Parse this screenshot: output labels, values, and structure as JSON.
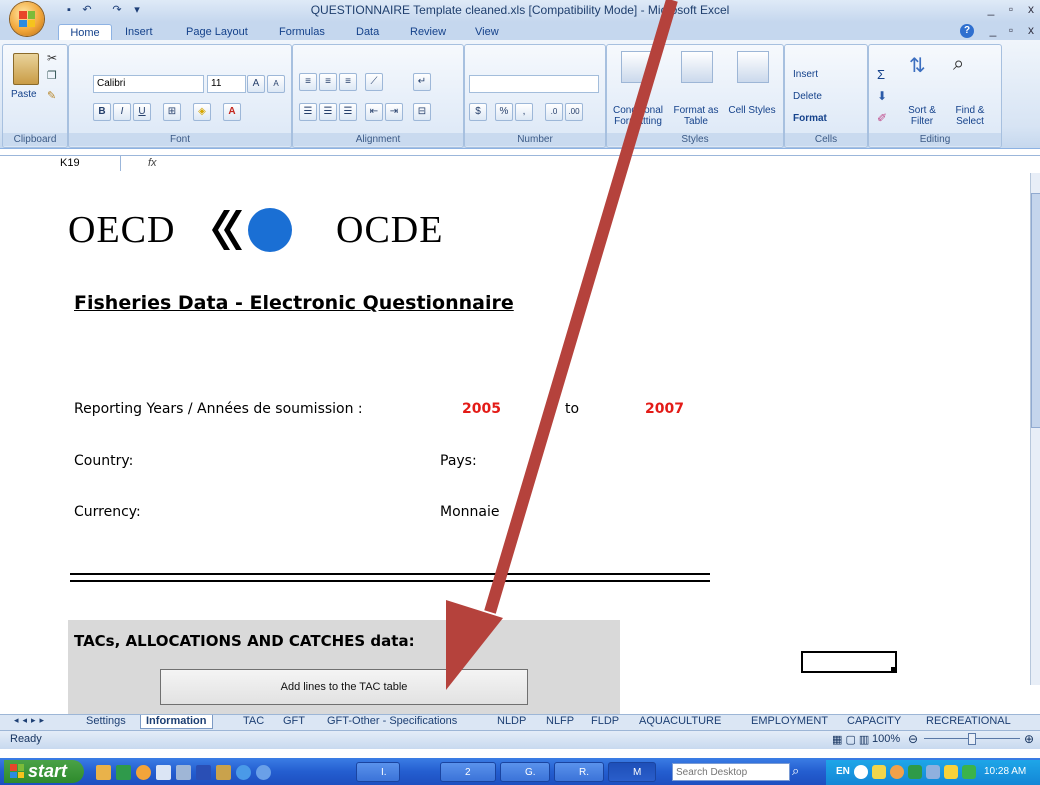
{
  "window": {
    "title": "QUESTIONNAIRE Template cleaned.xls  [Compatibility Mode]  - Microsoft Excel",
    "minimize": "_",
    "restore": "▫",
    "close": "x",
    "help": "?"
  },
  "ribbon_tabs": [
    "Home",
    "Insert",
    "Page Layout",
    "Formulas",
    "Data",
    "Review",
    "View"
  ],
  "ribbon": {
    "clipboard": {
      "label": "Clipboard",
      "paste": "Paste"
    },
    "font": {
      "label": "Font",
      "font_name": "Calibri",
      "font_size": "11",
      "bold": "B",
      "italic": "I",
      "underline": "U"
    },
    "alignment": {
      "label": "Alignment"
    },
    "number": {
      "label": "Number",
      "percent": "%",
      "comma": ","
    },
    "styles": {
      "label": "Styles",
      "conditional": "Conditional Formatting",
      "format_table": "Format as Table",
      "cell_styles": "Cell Styles"
    },
    "cells": {
      "label": "Cells",
      "insert": "Insert",
      "delete": "Delete",
      "format": "Format"
    },
    "editing": {
      "label": "Editing",
      "sigma": "Σ",
      "sort": "Sort & Filter",
      "find": "Find & Select"
    }
  },
  "formula_bar": {
    "name_box": "K19",
    "fx": "fx",
    "value": ""
  },
  "sheet": {
    "logo_left": "OECD",
    "logo_right": "OCDE",
    "title": "Fisheries Data - Electronic Questionnaire",
    "reporting_label": "Reporting Years / Années de soumission :",
    "year_from": "2005",
    "to": "to",
    "year_to": "2007",
    "country": "Country:",
    "pays": "Pays:",
    "currency": "Currency:",
    "monnaie": "Monnaie",
    "tac_heading": "TACs, ALLOCATIONS AND CATCHES data:",
    "tac_button": "Add lines to the TAC table"
  },
  "sheet_tabs": [
    "Settings",
    "Information",
    "TAC",
    "GFT",
    "GFT-Other - Specifications",
    "NLDP",
    "NLFP",
    "FLDP",
    "AQUACULTURE",
    "EMPLOYMENT",
    "CAPACITY",
    "RECREATIONAL"
  ],
  "active_sheet": "Information",
  "status": {
    "ready": "Ready",
    "zoom": "100%"
  },
  "taskbar": {
    "start": "start",
    "buttons": [
      "I.",
      "2",
      "G.",
      "R.",
      "M"
    ],
    "search_placeholder": "Search Desktop",
    "lang": "EN",
    "clock": "10:28 AM"
  },
  "colors": {
    "arrow": "#b5423c",
    "year_red": "#e31b17",
    "oecd_blue": "#1a6fd4"
  }
}
